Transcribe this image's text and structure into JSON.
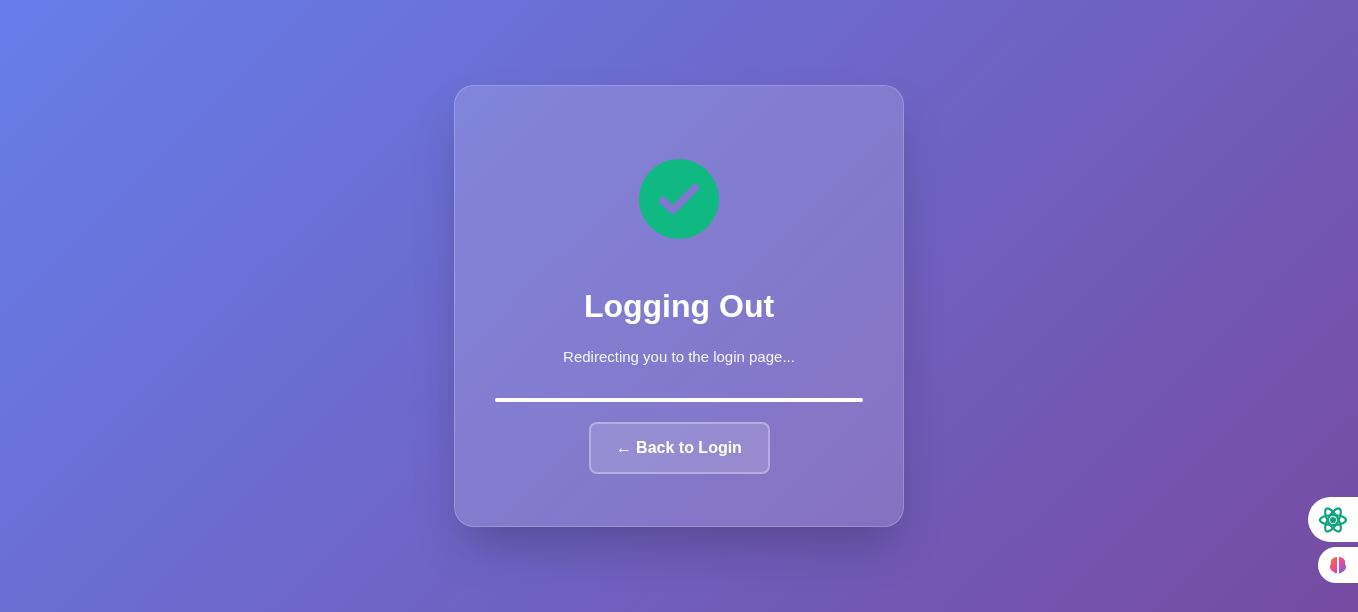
{
  "card": {
    "title": "Logging Out",
    "message": "Redirecting you to the login page...",
    "progress": {
      "level": 1
    },
    "button": {
      "icon": "←",
      "label": "Back to Login"
    }
  },
  "side_buttons": [
    {
      "kind": "ai"
    },
    {
      "kind": "brain"
    }
  ]
}
